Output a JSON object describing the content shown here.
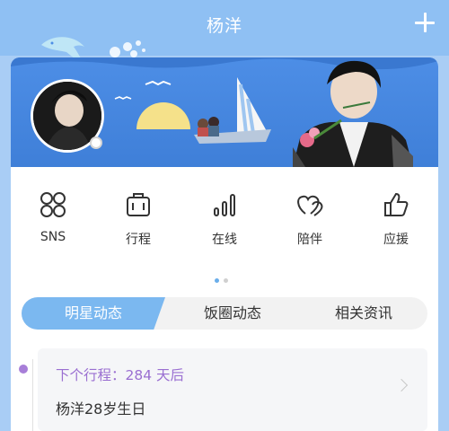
{
  "header": {
    "title": "杨洋",
    "add_icon": "plus-icon"
  },
  "menu": {
    "items": [
      {
        "label": "SNS",
        "icon": "four-circles-icon"
      },
      {
        "label": "行程",
        "icon": "luggage-icon"
      },
      {
        "label": "在线",
        "icon": "signal-bars-icon"
      },
      {
        "label": "陪伴",
        "icon": "hearts-icon"
      },
      {
        "label": "应援",
        "icon": "thumbs-up-icon"
      }
    ],
    "page_count": 2,
    "active_page": 1
  },
  "tabs": [
    {
      "label": "明星动态",
      "active": true
    },
    {
      "label": "饭圈动态",
      "active": false
    },
    {
      "label": "相关资讯",
      "active": false
    }
  ],
  "event": {
    "next_schedule": "下个行程：284 天后",
    "name": "杨洋28岁生日"
  },
  "colors": {
    "accent": "#7bb8f0",
    "header": "#8fc0f3",
    "event_highlight": "#9a6fd1",
    "banner": "#4d8ee6"
  }
}
